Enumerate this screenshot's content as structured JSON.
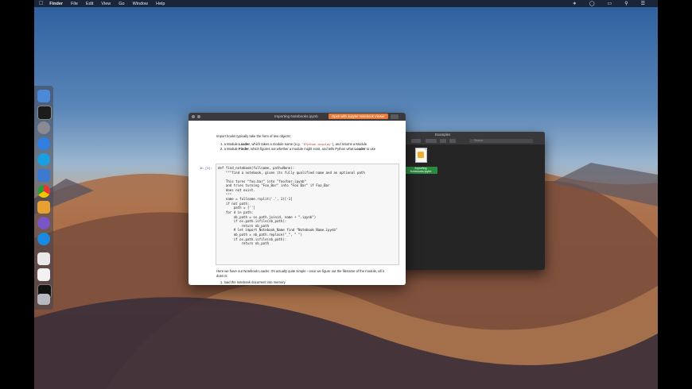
{
  "menubar": {
    "app": "Finder",
    "items": [
      "File",
      "Edit",
      "View",
      "Go",
      "Window",
      "Help"
    ]
  },
  "notebook": {
    "title": "Importing Notebooks.ipynb",
    "open_button": "Open with Jupyter Notebook Viewer",
    "intro": "Import hooks typically take the form of two objects:",
    "list1_a": "1. a Module ",
    "list1_b": "Loader",
    "list1_c": ", which takes a module name (e.g. ",
    "list1_code": "'IPython.display'",
    "list1_d": "), and returns a Module",
    "list2_a": "2. a Module ",
    "list2_b": "Finder",
    "list2_c": ", which figures out whether a module might exist, and tells Python what ",
    "list2_d": "Loader",
    "list2_e": " to use",
    "prompt": "In [3]:",
    "code": [
      "def find_notebook(fullname, path=None):",
      "    \"\"\"find a notebook, given its fully qualified name and an optional path",
      "",
      "    This turns \"foo.bar\" into \"foo/bar.ipynb\"",
      "    and tries turning \"Foo_Bar\" into \"Foo Bar\" if Foo_Bar",
      "    does not exist.",
      "    \"\"\"",
      "    name = fullname.rsplit('.', 1)[-1]",
      "    if not path:",
      "        path = ['']",
      "    for d in path:",
      "        nb_path = os.path.join(d, name + \".ipynb\")",
      "        if os.path.isfile(nb_path):",
      "            return nb_path",
      "        # let import Notebook_Name find \"Notebook Name.ipynb\"",
      "        nb_path = nb_path.replace(\"_\", \" \")",
      "        if os.path.isfile(nb_path):",
      "            return nb_path"
    ],
    "para2_line1": "Here we have our Notebook Loader. It's actually quite simple - once we figure out the filename of the module, all it",
    "para2_line2": "does is:",
    "list3": "1. load the notebook document into memory"
  },
  "finder": {
    "title": "Examples",
    "search_placeholder": "Search",
    "file_label_line1": "Importing",
    "file_label_line2": "Notebooks.ipynb"
  },
  "colors": {
    "accent_orange": "#e87a37",
    "selection_green": "#2a8a3e",
    "prompt_blue": "#303f9f"
  }
}
